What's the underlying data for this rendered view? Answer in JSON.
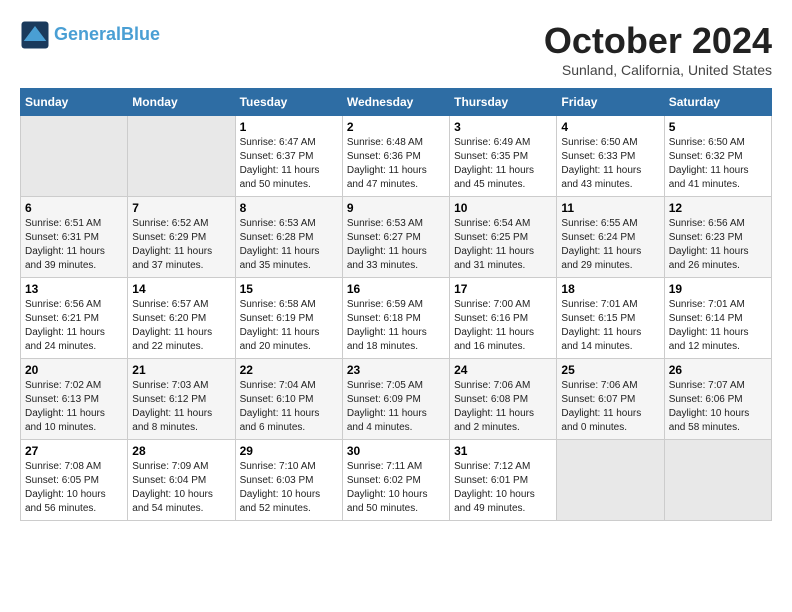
{
  "header": {
    "logo_line1": "General",
    "logo_line2": "Blue",
    "month": "October 2024",
    "location": "Sunland, California, United States"
  },
  "weekdays": [
    "Sunday",
    "Monday",
    "Tuesday",
    "Wednesday",
    "Thursday",
    "Friday",
    "Saturday"
  ],
  "weeks": [
    [
      {
        "day": "",
        "info": ""
      },
      {
        "day": "",
        "info": ""
      },
      {
        "day": "1",
        "info": "Sunrise: 6:47 AM\nSunset: 6:37 PM\nDaylight: 11 hours and 50 minutes."
      },
      {
        "day": "2",
        "info": "Sunrise: 6:48 AM\nSunset: 6:36 PM\nDaylight: 11 hours and 47 minutes."
      },
      {
        "day": "3",
        "info": "Sunrise: 6:49 AM\nSunset: 6:35 PM\nDaylight: 11 hours and 45 minutes."
      },
      {
        "day": "4",
        "info": "Sunrise: 6:50 AM\nSunset: 6:33 PM\nDaylight: 11 hours and 43 minutes."
      },
      {
        "day": "5",
        "info": "Sunrise: 6:50 AM\nSunset: 6:32 PM\nDaylight: 11 hours and 41 minutes."
      }
    ],
    [
      {
        "day": "6",
        "info": "Sunrise: 6:51 AM\nSunset: 6:31 PM\nDaylight: 11 hours and 39 minutes."
      },
      {
        "day": "7",
        "info": "Sunrise: 6:52 AM\nSunset: 6:29 PM\nDaylight: 11 hours and 37 minutes."
      },
      {
        "day": "8",
        "info": "Sunrise: 6:53 AM\nSunset: 6:28 PM\nDaylight: 11 hours and 35 minutes."
      },
      {
        "day": "9",
        "info": "Sunrise: 6:53 AM\nSunset: 6:27 PM\nDaylight: 11 hours and 33 minutes."
      },
      {
        "day": "10",
        "info": "Sunrise: 6:54 AM\nSunset: 6:25 PM\nDaylight: 11 hours and 31 minutes."
      },
      {
        "day": "11",
        "info": "Sunrise: 6:55 AM\nSunset: 6:24 PM\nDaylight: 11 hours and 29 minutes."
      },
      {
        "day": "12",
        "info": "Sunrise: 6:56 AM\nSunset: 6:23 PM\nDaylight: 11 hours and 26 minutes."
      }
    ],
    [
      {
        "day": "13",
        "info": "Sunrise: 6:56 AM\nSunset: 6:21 PM\nDaylight: 11 hours and 24 minutes."
      },
      {
        "day": "14",
        "info": "Sunrise: 6:57 AM\nSunset: 6:20 PM\nDaylight: 11 hours and 22 minutes."
      },
      {
        "day": "15",
        "info": "Sunrise: 6:58 AM\nSunset: 6:19 PM\nDaylight: 11 hours and 20 minutes."
      },
      {
        "day": "16",
        "info": "Sunrise: 6:59 AM\nSunset: 6:18 PM\nDaylight: 11 hours and 18 minutes."
      },
      {
        "day": "17",
        "info": "Sunrise: 7:00 AM\nSunset: 6:16 PM\nDaylight: 11 hours and 16 minutes."
      },
      {
        "day": "18",
        "info": "Sunrise: 7:01 AM\nSunset: 6:15 PM\nDaylight: 11 hours and 14 minutes."
      },
      {
        "day": "19",
        "info": "Sunrise: 7:01 AM\nSunset: 6:14 PM\nDaylight: 11 hours and 12 minutes."
      }
    ],
    [
      {
        "day": "20",
        "info": "Sunrise: 7:02 AM\nSunset: 6:13 PM\nDaylight: 11 hours and 10 minutes."
      },
      {
        "day": "21",
        "info": "Sunrise: 7:03 AM\nSunset: 6:12 PM\nDaylight: 11 hours and 8 minutes."
      },
      {
        "day": "22",
        "info": "Sunrise: 7:04 AM\nSunset: 6:10 PM\nDaylight: 11 hours and 6 minutes."
      },
      {
        "day": "23",
        "info": "Sunrise: 7:05 AM\nSunset: 6:09 PM\nDaylight: 11 hours and 4 minutes."
      },
      {
        "day": "24",
        "info": "Sunrise: 7:06 AM\nSunset: 6:08 PM\nDaylight: 11 hours and 2 minutes."
      },
      {
        "day": "25",
        "info": "Sunrise: 7:06 AM\nSunset: 6:07 PM\nDaylight: 11 hours and 0 minutes."
      },
      {
        "day": "26",
        "info": "Sunrise: 7:07 AM\nSunset: 6:06 PM\nDaylight: 10 hours and 58 minutes."
      }
    ],
    [
      {
        "day": "27",
        "info": "Sunrise: 7:08 AM\nSunset: 6:05 PM\nDaylight: 10 hours and 56 minutes."
      },
      {
        "day": "28",
        "info": "Sunrise: 7:09 AM\nSunset: 6:04 PM\nDaylight: 10 hours and 54 minutes."
      },
      {
        "day": "29",
        "info": "Sunrise: 7:10 AM\nSunset: 6:03 PM\nDaylight: 10 hours and 52 minutes."
      },
      {
        "day": "30",
        "info": "Sunrise: 7:11 AM\nSunset: 6:02 PM\nDaylight: 10 hours and 50 minutes."
      },
      {
        "day": "31",
        "info": "Sunrise: 7:12 AM\nSunset: 6:01 PM\nDaylight: 10 hours and 49 minutes."
      },
      {
        "day": "",
        "info": ""
      },
      {
        "day": "",
        "info": ""
      }
    ]
  ]
}
